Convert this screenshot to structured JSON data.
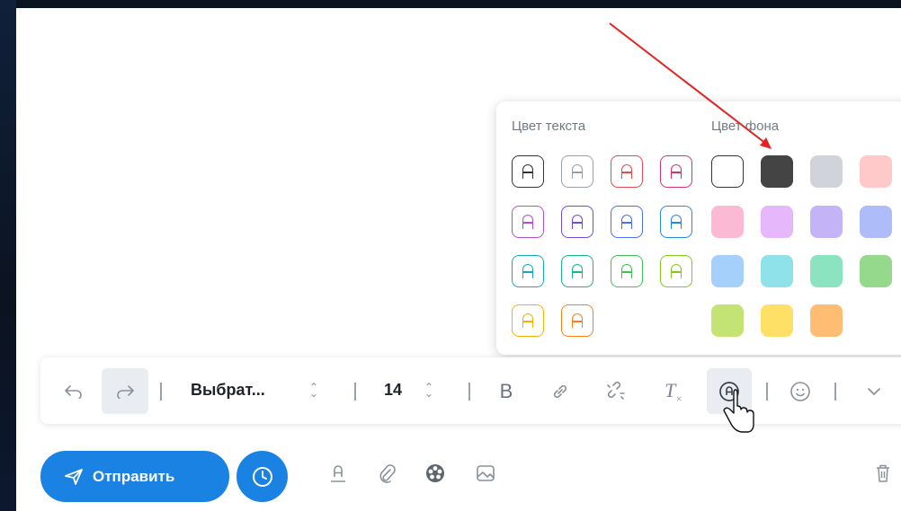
{
  "popover": {
    "text_color_title": "Цвет текста",
    "bg_color_title": "Цвет фона",
    "text_color_letter": "A",
    "text_colors": [
      "#333333",
      "#9aa0a8",
      "#e5484d",
      "#d6336c",
      "#b14fd8",
      "#7048e8",
      "#4c6ef5",
      "#228be6",
      "#15aabf",
      "#12b886",
      "#40c057",
      "#82c91e",
      "#fab005",
      "#fd7e14"
    ],
    "bg_colors": [
      "#ffffff",
      "#444444",
      "#d0d4da",
      "#ffc9c9",
      "#fcb9d4",
      "#e6b8fb",
      "#c5b3f8",
      "#aebcfa",
      "#a5d0fc",
      "#8fe1ea",
      "#8be3c0",
      "#95d98d",
      "#c3e374",
      "#ffe066",
      "#ffbc73"
    ]
  },
  "toolbar": {
    "font_name": "Выбрат...",
    "font_size": "14",
    "icons": [
      "undo-icon",
      "redo-icon",
      "bold-icon",
      "link-icon",
      "unlink-icon",
      "clear-format-icon",
      "text-color-icon",
      "emoji-icon",
      "chevron-down-icon"
    ]
  },
  "bottom": {
    "send_label": "Отправить",
    "icons": [
      "clock-icon",
      "font-format-icon",
      "paperclip-icon",
      "palette-icon",
      "image-icon",
      "trash-icon"
    ]
  },
  "colors": {
    "accent": "#1a82e2",
    "annotation_arrow": "#e52222"
  }
}
